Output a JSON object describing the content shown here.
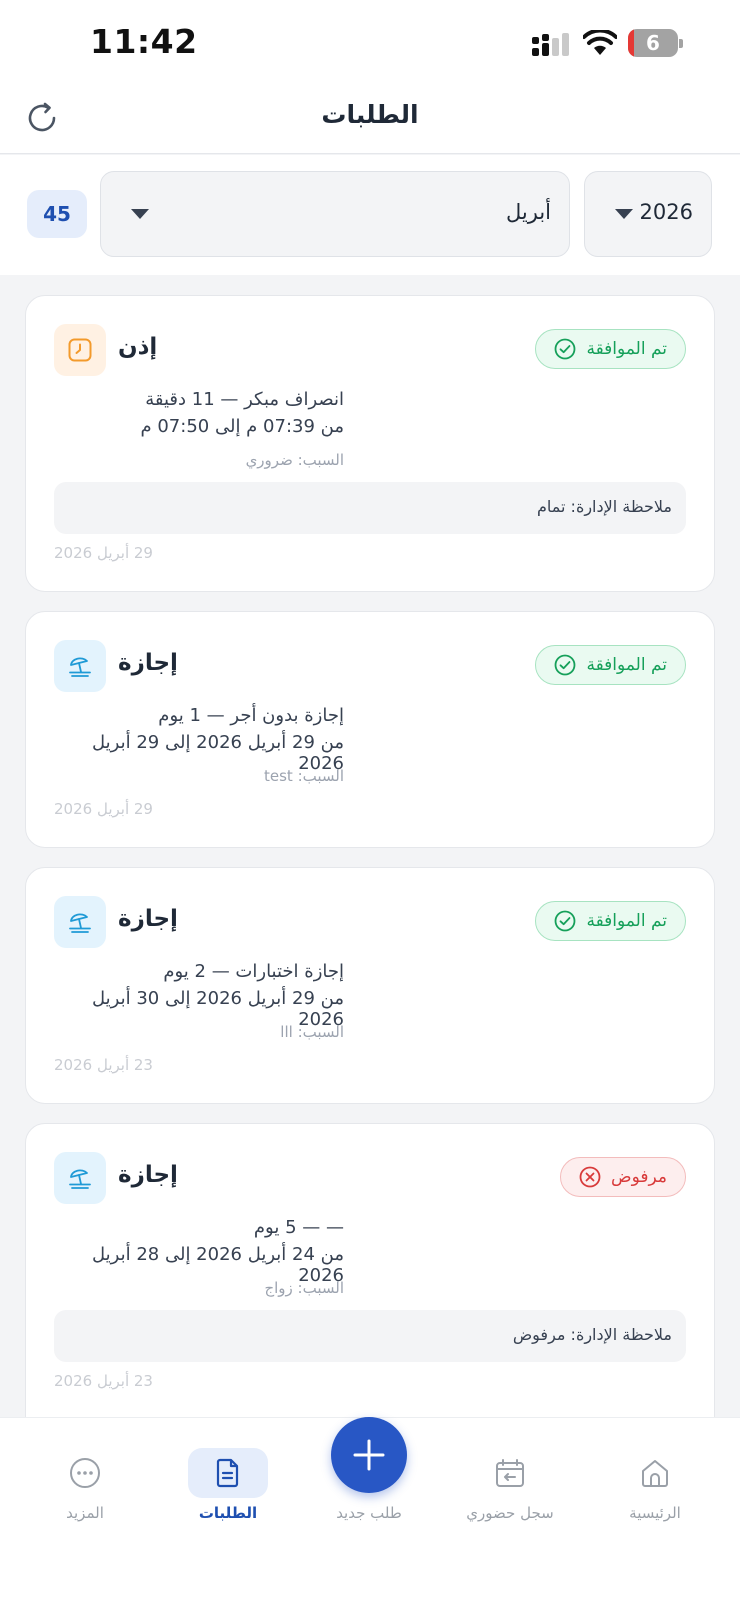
{
  "status_bar": {
    "time": "11:42",
    "battery": "6"
  },
  "header": {
    "title": "الطلبات"
  },
  "filters": {
    "year": "2026",
    "month": "أبريل",
    "count": "45"
  },
  "requests": [
    {
      "type": "إذن",
      "icon": "clock-icon",
      "status": "تم الموافقة",
      "status_kind": "approved",
      "detail": "انصراف مبكر — 11 دقيقة",
      "range": "من 07:39 م إلى 07:50 م",
      "reason": "السبب: ضروري",
      "note": "ملاحظة الإدارة: تمام",
      "date": "29 أبريل 2026"
    },
    {
      "type": "إجازة",
      "icon": "beach-umbrella-icon",
      "status": "تم الموافقة",
      "status_kind": "approved",
      "detail": "إجازة بدون أجر — 1 يوم",
      "range": "من 29 أبريل 2026 إلى 29 أبريل 2026",
      "reason": "السبب: test",
      "date": "29 أبريل 2026"
    },
    {
      "type": "إجازة",
      "icon": "beach-umbrella-icon",
      "status": "تم الموافقة",
      "status_kind": "approved",
      "detail": "إجازة اختبارات — 2 يوم",
      "range": "من 29 أبريل 2026 إلى 30 أبريل 2026",
      "reason": "السبب: lll",
      "date": "23 أبريل 2026"
    },
    {
      "type": "إجازة",
      "icon": "beach-umbrella-icon",
      "status": "مرفوض",
      "status_kind": "rejected",
      "detail": "— — 5 يوم",
      "range": "من 24 أبريل 2026 إلى 28 أبريل 2026",
      "reason": "السبب: زواج",
      "note": "ملاحظة الإدارة: مرفوض",
      "date": "23 أبريل 2026"
    }
  ],
  "bottom_nav": {
    "home": "الرئيسية",
    "attendance": "سجل حضوري",
    "new_request": "طلب جديد",
    "requests": "الطلبات",
    "more": "المزيد"
  },
  "colors": {
    "primary": "#2857c5",
    "approved": "#16a05a",
    "rejected": "#d83a3a",
    "permission_icon": "#f39a2b",
    "leave_icon": "#1f9ad6"
  }
}
